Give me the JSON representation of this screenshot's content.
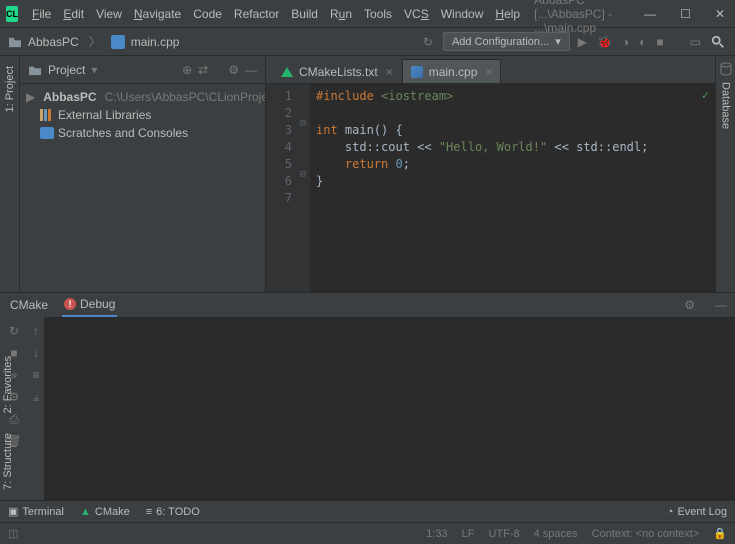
{
  "menu": {
    "file": "File",
    "edit": "Edit",
    "view": "View",
    "navigate": "Navigate",
    "code": "Code",
    "refactor": "Refactor",
    "build": "Build",
    "run": "Run",
    "tools": "Tools",
    "vcs": "VCS",
    "window": "Window",
    "help": "Help"
  },
  "title_path": "AbbasPC [...\\AbbasPC] - ...\\main.cpp",
  "breadcrumb": {
    "root": "AbbasPC",
    "file": "main.cpp"
  },
  "run_config": {
    "label": "Add Configuration..."
  },
  "project_panel": {
    "title": "Project",
    "root": {
      "name": "AbbasPC",
      "path": "C:\\Users\\AbbasPC\\CLionProjects\\Abba"
    },
    "external_libs": "External Libraries",
    "scratches": "Scratches and Consoles"
  },
  "tabs": [
    {
      "label": "CMakeLists.txt",
      "active": false
    },
    {
      "label": "main.cpp",
      "active": true
    }
  ],
  "code": {
    "lines": [
      "1",
      "2",
      "3",
      "4",
      "5",
      "6",
      "7"
    ],
    "l1_kw": "#include ",
    "l1_inc": "<iostream>",
    "l3": "int main() {",
    "l3_kw": "int",
    "l3_rest": " main() {",
    "l4_indent": "    std::cout << ",
    "l4_str": "\"Hello, World!\"",
    "l4_rest": " << std::endl;",
    "l5_indent": "    ",
    "l5_kw": "return ",
    "l5_num": "0",
    "l5_semi": ";",
    "l6": "}"
  },
  "tool_tabs": {
    "cmake": "CMake",
    "debug": "Debug"
  },
  "bottom": {
    "terminal": "Terminal",
    "cmake": "CMake",
    "todo": "6: TODO",
    "eventlog": "Event Log"
  },
  "status": {
    "pos": "1:33",
    "linesep": "LF",
    "enc": "UTF-8",
    "indent": "4 spaces",
    "context": "Context: <no context>"
  },
  "side": {
    "project": "1: Project",
    "favorites": "2: Favorites",
    "structure": "7: Structure",
    "database": "Database"
  }
}
